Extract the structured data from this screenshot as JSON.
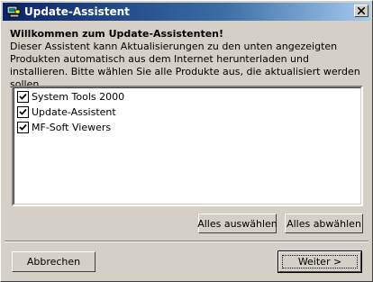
{
  "window": {
    "title": "Update-Assistent",
    "app_icon": "computer-icon",
    "close_icon": "close-icon"
  },
  "content": {
    "heading": "Willkommen zum Update-Assistenten!",
    "description": "Dieser Assistent kann Aktualisierungen zu den unten angezeigten Produkten automatisch aus dem Internet herunterladen und installieren. Bitte wählen Sie alle Produkte aus, die aktualisiert werden sollen."
  },
  "products": [
    {
      "label": "System Tools 2000",
      "checked": true
    },
    {
      "label": "Update-Assistent",
      "checked": true
    },
    {
      "label": "MF-Soft Viewers",
      "checked": true
    }
  ],
  "buttons": {
    "select_all": "Alles auswählen",
    "deselect_all": "Alles abwählen",
    "cancel": "Abbrechen",
    "next": "Weiter >"
  }
}
